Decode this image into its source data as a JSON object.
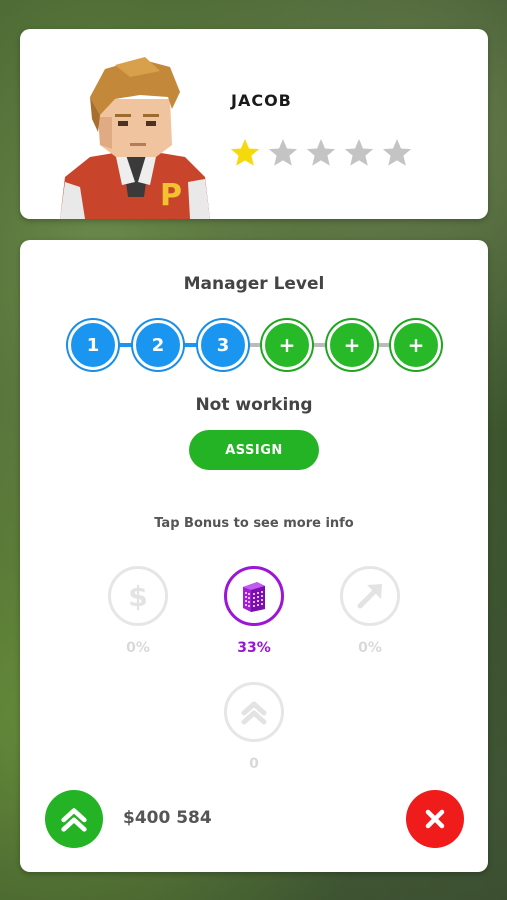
{
  "manager": {
    "name": "JACOB",
    "rating": 1,
    "rating_max": 5
  },
  "panel": {
    "title": "Manager Level",
    "levels": [
      {
        "label": "1",
        "state": "unlocked"
      },
      {
        "label": "2",
        "state": "unlocked"
      },
      {
        "label": "3",
        "state": "unlocked"
      },
      {
        "label": "+",
        "state": "upgradable"
      },
      {
        "label": "+",
        "state": "upgradable"
      },
      {
        "label": "+",
        "state": "upgradable"
      }
    ],
    "status": "Not working",
    "assign_label": "ASSIGN",
    "hint": "Tap Bonus to see more info"
  },
  "bonuses": {
    "money": {
      "icon": "dollar-icon",
      "value": "0%",
      "active": false
    },
    "building": {
      "icon": "building-icon",
      "value": "33%",
      "active": true
    },
    "speed": {
      "icon": "arrow-up-right-icon",
      "value": "0%",
      "active": false
    },
    "upgrade": {
      "icon": "double-chevron-up-icon",
      "value": "0",
      "active": false
    }
  },
  "footer": {
    "price": "$400 584"
  },
  "colors": {
    "blue": "#1a96f0",
    "green": "#24b324",
    "purple": "#9b16d6",
    "red": "#f01b1b",
    "star_gold": "#f5d90a",
    "star_gray": "#c4c4c4"
  }
}
